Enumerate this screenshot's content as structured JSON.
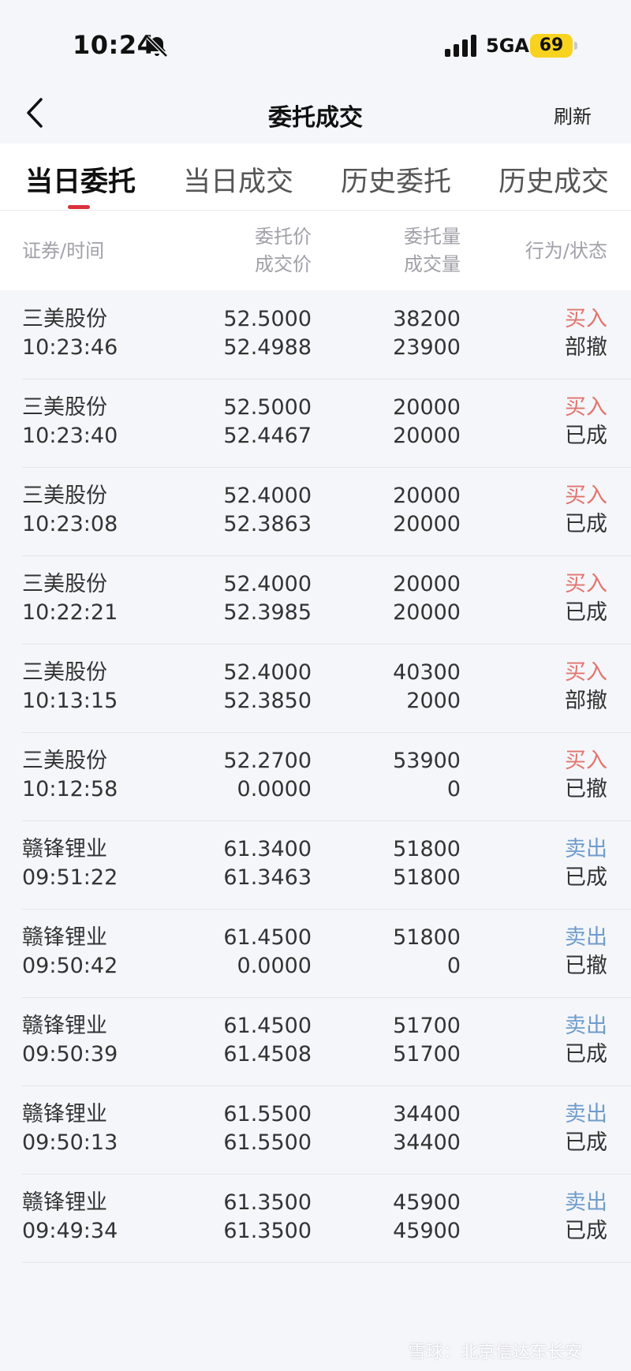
{
  "status_bar": {
    "time": "10:24",
    "network": "5GA",
    "battery": "69",
    "battery_color": "#f7d320",
    "icons": [
      "bell-muted-icon",
      "signal-icon"
    ]
  },
  "nav": {
    "title": "委托成交",
    "refresh": "刷新",
    "back_icon": "chevron-left-icon"
  },
  "tabs": [
    "当日委托",
    "当日成交",
    "历史委托",
    "历史成交"
  ],
  "active_tab": 0,
  "accent_color": "#d9323b",
  "header": {
    "security_time": "证券/时间",
    "order_price": "委托价",
    "deal_price": "成交价",
    "order_qty": "委托量",
    "deal_qty": "成交量",
    "action_status": "行为/状态"
  },
  "rows": [
    {
      "name": "三美股份",
      "time": "10:23:46",
      "order_price": "52.5000",
      "deal_price": "52.4988",
      "order_qty": "38200",
      "deal_qty": "23900",
      "action": "买入",
      "status": "部撤"
    },
    {
      "name": "三美股份",
      "time": "10:23:40",
      "order_price": "52.5000",
      "deal_price": "52.4467",
      "order_qty": "20000",
      "deal_qty": "20000",
      "action": "买入",
      "status": "已成"
    },
    {
      "name": "三美股份",
      "time": "10:23:08",
      "order_price": "52.4000",
      "deal_price": "52.3863",
      "order_qty": "20000",
      "deal_qty": "20000",
      "action": "买入",
      "status": "已成"
    },
    {
      "name": "三美股份",
      "time": "10:22:21",
      "order_price": "52.4000",
      "deal_price": "52.3985",
      "order_qty": "20000",
      "deal_qty": "20000",
      "action": "买入",
      "status": "已成"
    },
    {
      "name": "三美股份",
      "time": "10:13:15",
      "order_price": "52.4000",
      "deal_price": "52.3850",
      "order_qty": "40300",
      "deal_qty": "2000",
      "action": "买入",
      "status": "部撤"
    },
    {
      "name": "三美股份",
      "time": "10:12:58",
      "order_price": "52.2700",
      "deal_price": "0.0000",
      "order_qty": "53900",
      "deal_qty": "0",
      "action": "买入",
      "status": "已撤"
    },
    {
      "name": "赣锋锂业",
      "time": "09:51:22",
      "order_price": "61.3400",
      "deal_price": "61.3463",
      "order_qty": "51800",
      "deal_qty": "51800",
      "action": "卖出",
      "status": "已成"
    },
    {
      "name": "赣锋锂业",
      "time": "09:50:42",
      "order_price": "61.4500",
      "deal_price": "0.0000",
      "order_qty": "51800",
      "deal_qty": "0",
      "action": "卖出",
      "status": "已撤"
    },
    {
      "name": "赣锋锂业",
      "time": "09:50:39",
      "order_price": "61.4500",
      "deal_price": "61.4508",
      "order_qty": "51700",
      "deal_qty": "51700",
      "action": "卖出",
      "status": "已成"
    },
    {
      "name": "赣锋锂业",
      "time": "09:50:13",
      "order_price": "61.5500",
      "deal_price": "61.5500",
      "order_qty": "34400",
      "deal_qty": "34400",
      "action": "卖出",
      "status": "已成"
    },
    {
      "name": "赣锋锂业",
      "time": "09:49:34",
      "order_price": "61.3500",
      "deal_price": "61.3500",
      "order_qty": "45900",
      "deal_qty": "45900",
      "action": "卖出",
      "status": "已成"
    }
  ],
  "colors": {
    "buy": "#e0766f",
    "sell": "#6f9ccc"
  },
  "watermark": "雪球：北京信达东长安"
}
